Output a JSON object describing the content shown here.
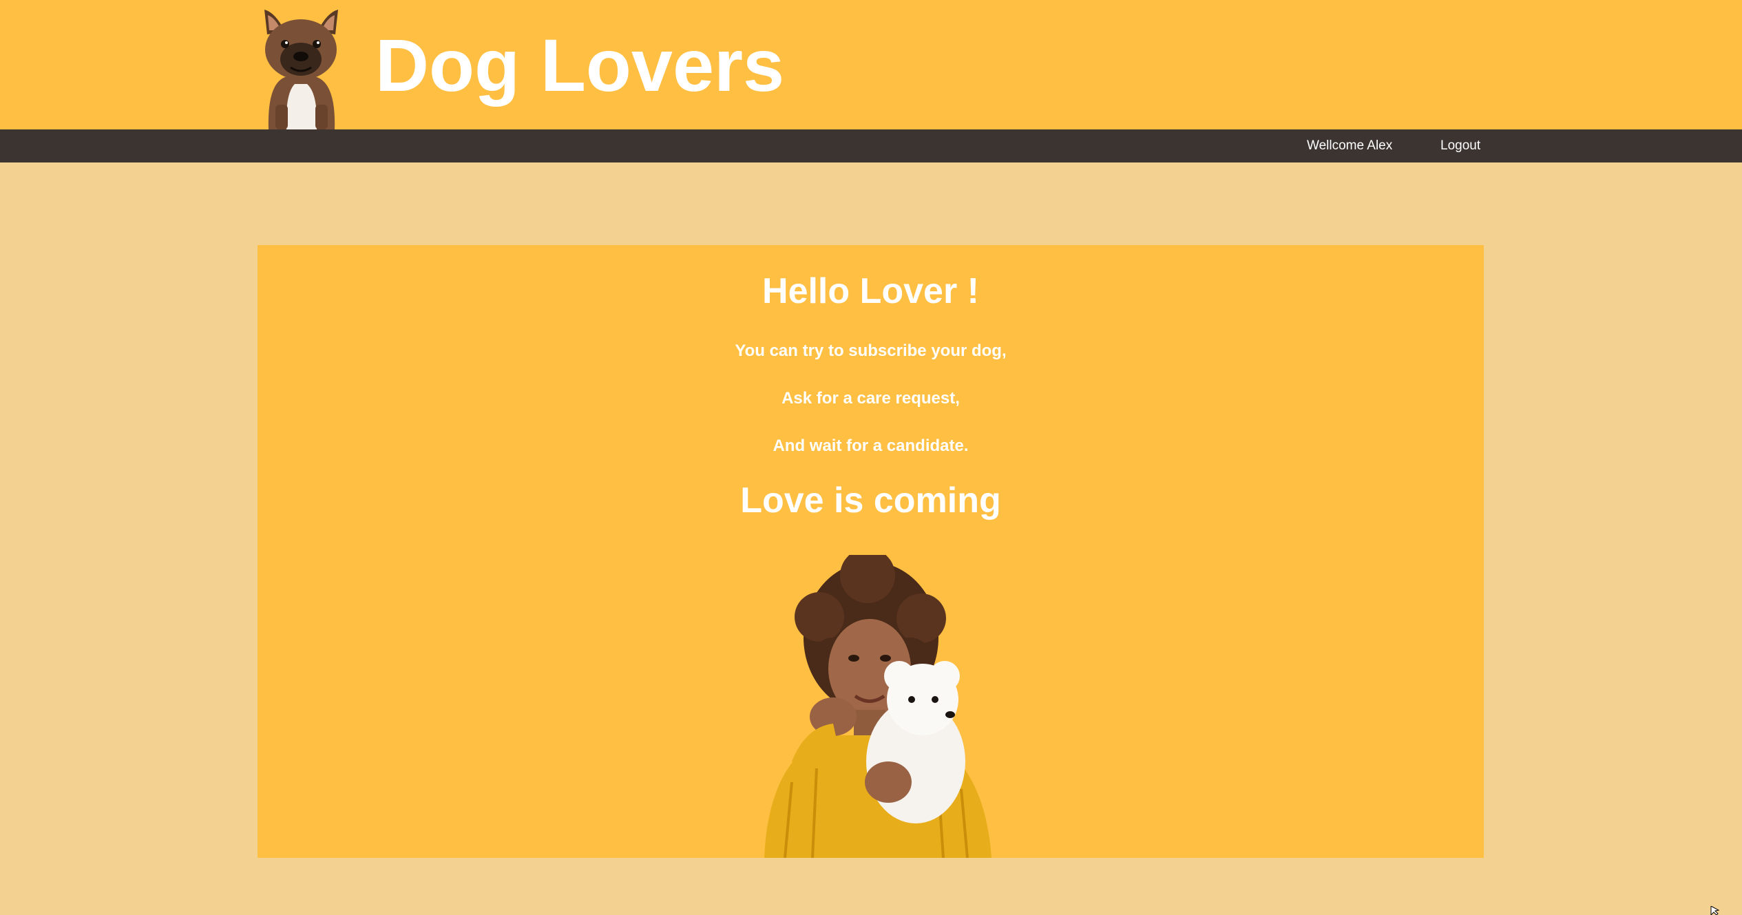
{
  "header": {
    "title": "Dog Lovers",
    "logo_icon": "french-bulldog-icon",
    "background": "#ffbf43"
  },
  "nav": {
    "welcome": "Wellcome Alex",
    "logout": "Logout",
    "background": "#3c3431"
  },
  "main": {
    "heading": "Hello Lover !",
    "lines": [
      "You can try to subscribe your dog,",
      "Ask for a care request,",
      "And wait for a candidate."
    ],
    "tagline": "Love is coming",
    "photo_icon": "woman-holding-dog-illustration"
  },
  "colors": {
    "page_background": "#f3d191",
    "panel_background": "#ffbf43",
    "text": "#ffffff"
  }
}
